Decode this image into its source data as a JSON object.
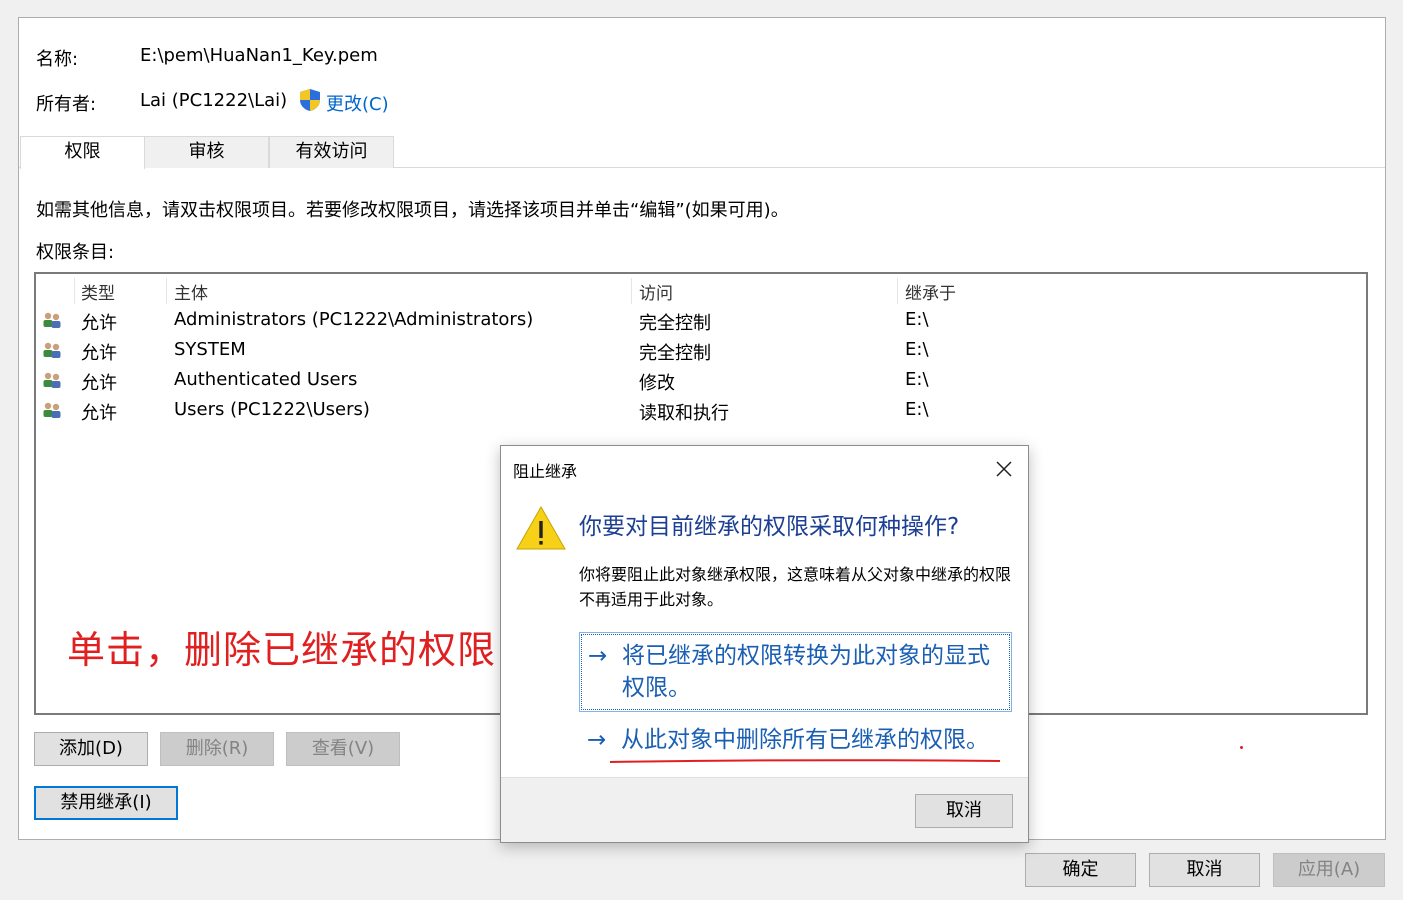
{
  "info": {
    "name_label": "名称:",
    "name_value": "E:\\pem\\HuaNan1_Key.pem",
    "owner_label": "所有者:",
    "owner_value": "Lai (PC1222\\Lai)",
    "change_link": "更改(C)"
  },
  "tabs": [
    {
      "label": "权限",
      "active": true
    },
    {
      "label": "审核",
      "active": false
    },
    {
      "label": "有效访问",
      "active": false
    }
  ],
  "hint_text": "如需其他信息，请双击权限项目。若要修改权限项目，请选择该项目并单击“编辑”(如果可用)。",
  "entries_label": "权限条目:",
  "table": {
    "headers": [
      "类型",
      "主体",
      "访问",
      "继承于"
    ],
    "rows": [
      {
        "type": "允许",
        "principal": "Administrators (PC1222\\Administrators)",
        "access": "完全控制",
        "inherited_from": "E:\\"
      },
      {
        "type": "允许",
        "principal": "SYSTEM",
        "access": "完全控制",
        "inherited_from": "E:\\"
      },
      {
        "type": "允许",
        "principal": "Authenticated Users",
        "access": "修改",
        "inherited_from": "E:\\"
      },
      {
        "type": "允许",
        "principal": "Users (PC1222\\Users)",
        "access": "读取和执行",
        "inherited_from": "E:\\"
      }
    ]
  },
  "annotation": "单击，删除已继承的权限",
  "buttons": {
    "add": "添加(D)",
    "remove": "删除(R)",
    "view": "查看(V)",
    "disable_inheritance": "禁用继承(I)",
    "ok": "确定",
    "cancel": "取消",
    "apply": "应用(A)"
  },
  "dialog": {
    "title": "阻止继承",
    "heading": "你要对目前继承的权限采取何种操作?",
    "body": "你将要阻止此对象继承权限，这意味着从父对象中继承的权限不再适用于此对象。",
    "option_convert": "将已继承的权限转换为此对象的显式权限。",
    "option_remove": "从此对象中删除所有已继承的权限。",
    "cancel": "取消"
  },
  "colors": {
    "link": "#0066cc",
    "command": "#1a5fb4",
    "heading": "#1c3f94",
    "annotation": "#e02020",
    "warning": "#f7d117"
  }
}
